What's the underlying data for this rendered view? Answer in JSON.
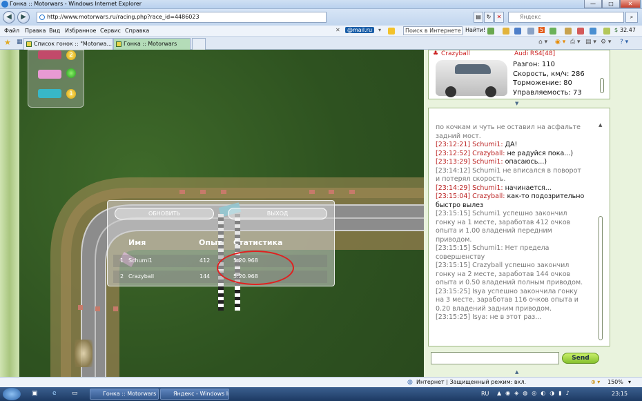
{
  "window": {
    "title": "Гонка :: Motorwars - Windows Internet Explorer",
    "min": "—",
    "max": "□",
    "close": "✕"
  },
  "address": {
    "url": "http://www.motorwars.ru/racing.php?race_id=4486023",
    "search_placeholder": "Яндекс"
  },
  "menu": [
    "Файл",
    "Правка",
    "Вид",
    "Избранное",
    "Сервис",
    "Справка"
  ],
  "toolbar": {
    "mail_label": "@mail.ru",
    "search_placeholder": "Поиск в Интернете",
    "find_label": "Найти!",
    "money": "32.47",
    "badge_count": "5"
  },
  "tabs": [
    {
      "label": "Список гонок :: \"Motorwa..."
    },
    {
      "label": "Гонка :: Motorwars"
    }
  ],
  "race": {
    "refresh_label": "ОБНОВИТЬ",
    "exit_label": "ВЫХОД",
    "col_name": "Имя",
    "col_exp": "Опыт",
    "col_stats": "Статистика",
    "rows": [
      {
        "pos": "1",
        "name": "Schumi1",
        "exp": "412",
        "time": "5:20.968"
      },
      {
        "pos": "2",
        "name": "Crazyball",
        "exp": "144",
        "time": "5:20.968"
      }
    ],
    "lights": [
      "2",
      "",
      "1"
    ]
  },
  "car": {
    "player": "Crazyball",
    "model": "Audi RS4[48]",
    "stats": [
      "Разгон: 110",
      "Скорость, км/ч: 286",
      "Торможение: 80",
      "Управляемость: 73"
    ]
  },
  "chat": {
    "lines": [
      {
        "ts": "",
        "name": "",
        "text": "по кочкам и чуть не оставил на асфальте",
        "type": "sys"
      },
      {
        "ts": "",
        "name": "",
        "text": "задний мост.",
        "type": "sys"
      },
      {
        "ts": "[23:12:21]",
        "name": "Schumi1:",
        "text": " ДА!",
        "type": "msg"
      },
      {
        "ts": "[23:12:52]",
        "name": "Crazyball:",
        "text": " не радуйся пока...)",
        "type": "msg"
      },
      {
        "ts": "[23:13:29]",
        "name": "Schumi1:",
        "text": " опасаюсь...)",
        "type": "msg"
      },
      {
        "ts": "",
        "name": "",
        "text": "[23:14:12] Schumi1 не вписался в поворот",
        "type": "sys"
      },
      {
        "ts": "",
        "name": "",
        "text": "и потерял скорость.",
        "type": "sys"
      },
      {
        "ts": "[23:14:29]",
        "name": "Schumi1:",
        "text": " начинается...",
        "type": "msg"
      },
      {
        "ts": "[23:15:04]",
        "name": "Crazyball:",
        "text": " как-то подозрительно",
        "type": "msg"
      },
      {
        "ts": "",
        "name": "",
        "text": "быстро вылез",
        "type": "plain"
      },
      {
        "ts": "",
        "name": "",
        "text": "[23:15:15] Schumi1 успешно закончил",
        "type": "sys"
      },
      {
        "ts": "",
        "name": "",
        "text": "гонку на 1 месте, заработав 412 очков",
        "type": "sys"
      },
      {
        "ts": "",
        "name": "",
        "text": "опыта и 1.00 владений передним",
        "type": "sys"
      },
      {
        "ts": "",
        "name": "",
        "text": "приводом.",
        "type": "sys"
      },
      {
        "ts": "",
        "name": "",
        "text": "[23:15:15] Schumi1: Нет предела",
        "type": "sys"
      },
      {
        "ts": "",
        "name": "",
        "text": "совершенству",
        "type": "sys"
      },
      {
        "ts": "",
        "name": "",
        "text": "[23:15:15] Crazyball успешно закончил",
        "type": "sys"
      },
      {
        "ts": "",
        "name": "",
        "text": "гонку на 2 месте, заработав 144 очков",
        "type": "sys"
      },
      {
        "ts": "",
        "name": "",
        "text": "опыта и 0.50 владений полным приводом.",
        "type": "sys"
      },
      {
        "ts": "",
        "name": "",
        "text": "[23:15:25] Isya успешно закончила гонку",
        "type": "sys"
      },
      {
        "ts": "",
        "name": "",
        "text": "на 3 месте, заработав 116 очков опыта и",
        "type": "sys"
      },
      {
        "ts": "",
        "name": "",
        "text": "0.20 владений задним приводом.",
        "type": "sys"
      },
      {
        "ts": "",
        "name": "",
        "text": "[23:15:25] Isya: не в этот раз...",
        "type": "sys"
      }
    ],
    "send_label": "Send"
  },
  "status": {
    "zone": "Интернет | Защищенный режим: вкл.",
    "zoom": "150%"
  },
  "taskbar": {
    "items": [
      "Гонка :: Motorwars - ...",
      "Яндекс - Windows In..."
    ],
    "lang": "RU",
    "clock": "23:15"
  },
  "colors": {
    "accent": "#2b7bd3",
    "send": "#86c12e",
    "highlight_circle": "#e02020"
  }
}
